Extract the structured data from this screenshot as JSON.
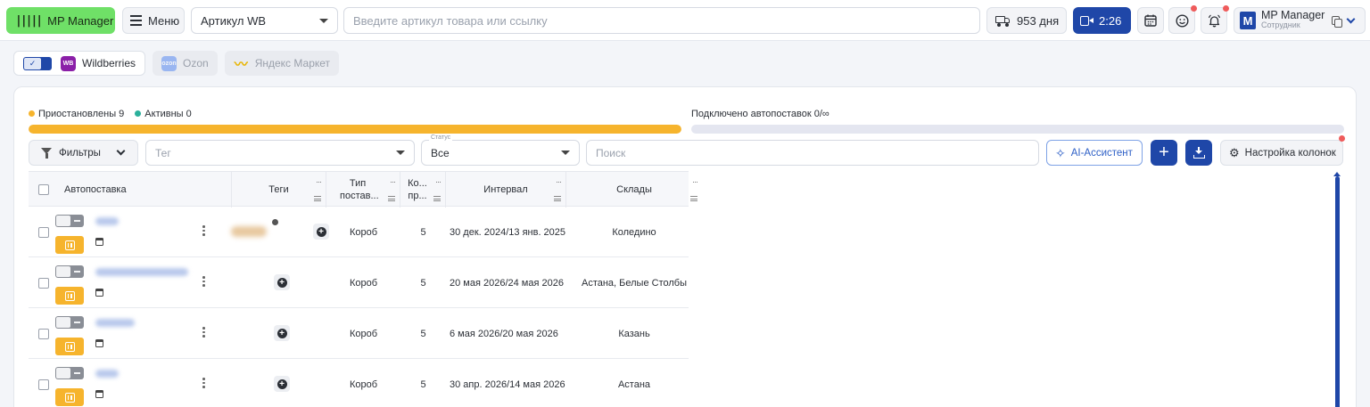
{
  "header": {
    "logo_label": "MP Manager",
    "logo_icon": "barcode-icon",
    "menu_label": "Меню",
    "article_select": "Артикул WB",
    "search_placeholder": "Введите артикул товара или ссылку",
    "days_label": "953 дня",
    "video_label": "2:26",
    "profile": {
      "initial": "M",
      "name": "MP Manager",
      "role": "Сотрудник"
    },
    "colors": {
      "logo_bg": "#6fe067",
      "primary": "#1f47a8",
      "notification": "#ef5b5b"
    }
  },
  "marketplaces": {
    "toggle_checked": true,
    "items": [
      {
        "label": "Wildberries",
        "badge": "WB",
        "active": true
      },
      {
        "label": "Ozon",
        "badge": "ozon",
        "active": false
      },
      {
        "label": "Яндекс Маркет",
        "badge": "ym",
        "active": false
      }
    ]
  },
  "stats": {
    "paused_label": "Приостановлены 9",
    "active_label": "Активны 0",
    "connected_label": "Подключено автопоставок 0/∞",
    "paused_fraction": 1.0,
    "connected_fraction": 0.0,
    "colors": {
      "paused": "#f6b42d",
      "active": "#2bb09b"
    }
  },
  "toolbar": {
    "filters_label": "Фильтры",
    "tag_placeholder": "Тег",
    "status_caption": "Статус",
    "status_value": "Все",
    "search_placeholder": "Поиск",
    "ai_label": "AI-Ассистент",
    "columns_label": "Настройка колонок"
  },
  "table": {
    "columns": {
      "name": "Автопоставка",
      "tags": "Теги",
      "type": "Тип постав...",
      "count": "Ко... пр...",
      "interval": "Интервал",
      "warehouses": "Склады"
    },
    "rows": [
      {
        "type": "Короб",
        "count": "5",
        "interval": "30 дек. 2024/13 янв. 2025",
        "warehouse": "Коледино"
      },
      {
        "type": "Короб",
        "count": "5",
        "interval": "20 мая 2026/24 мая 2026",
        "warehouse": "Астана, Белые Столбы"
      },
      {
        "type": "Короб",
        "count": "5",
        "interval": "6 мая 2026/20 мая 2026",
        "warehouse": "Казань"
      },
      {
        "type": "Короб",
        "count": "5",
        "interval": "30 апр. 2026/14 мая 2026",
        "warehouse": "Астана"
      }
    ]
  }
}
